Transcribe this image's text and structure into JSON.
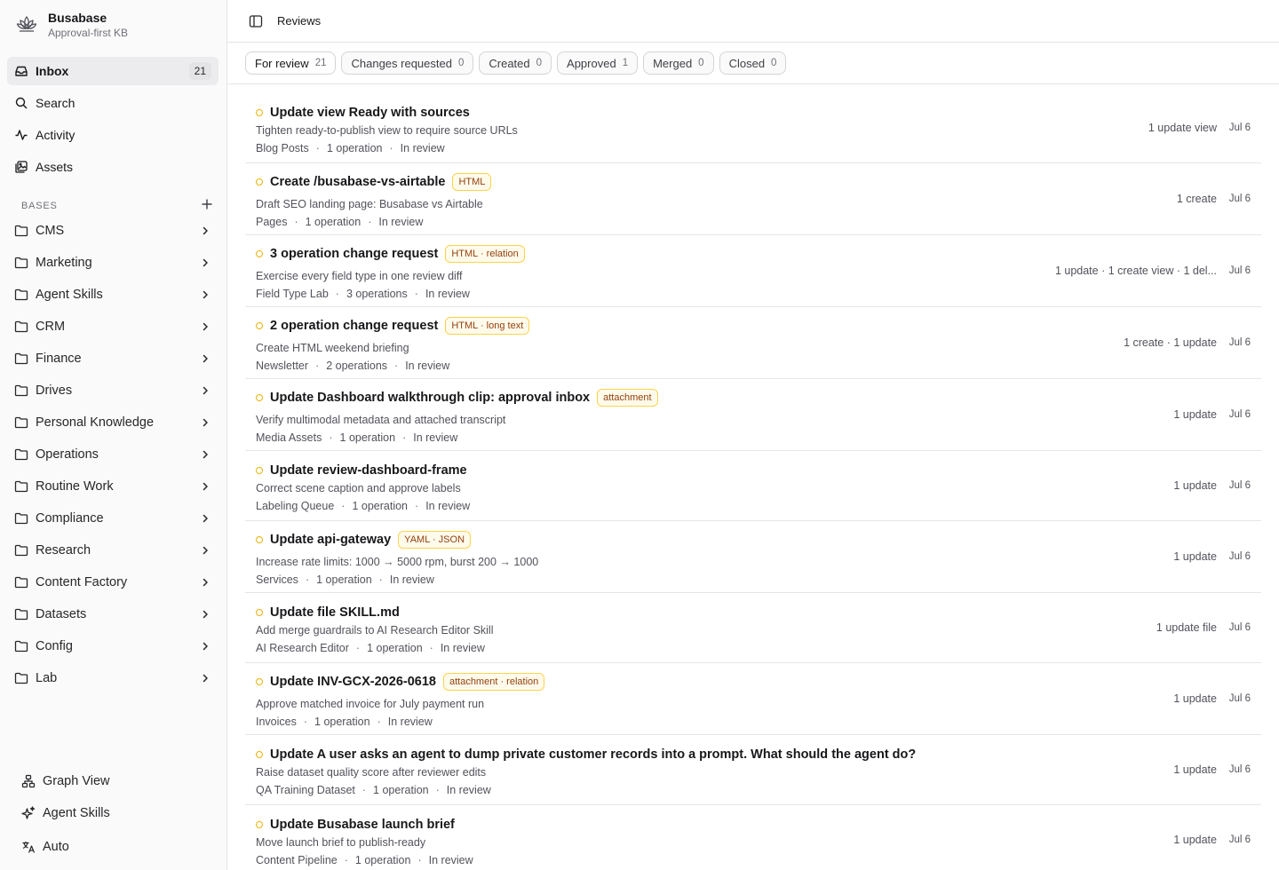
{
  "brand": {
    "name": "Busabase",
    "subtitle": "Approval-first KB"
  },
  "nav": [
    {
      "label": "Inbox",
      "badge": "21",
      "icon": "inbox-icon"
    },
    {
      "label": "Search",
      "icon": "search-icon"
    },
    {
      "label": "Activity",
      "icon": "activity-icon"
    },
    {
      "label": "Assets",
      "icon": "assets-icon"
    }
  ],
  "bases_label": "BASES",
  "bases": [
    "CMS",
    "Marketing",
    "Agent Skills",
    "CRM",
    "Finance",
    "Drives",
    "Personal Knowledge",
    "Operations",
    "Routine Work",
    "Compliance",
    "Research",
    "Content Factory",
    "Datasets",
    "Config",
    "Lab"
  ],
  "footer": [
    {
      "label": "Graph View",
      "icon": "graph-icon"
    },
    {
      "label": "Agent Skills",
      "icon": "sparkles-icon"
    },
    {
      "label": "Auto",
      "icon": "language-icon"
    }
  ],
  "header": {
    "title": "Reviews"
  },
  "tabs": [
    {
      "label": "For review",
      "count": "21",
      "active": true
    },
    {
      "label": "Changes requested",
      "count": "0"
    },
    {
      "label": "Created",
      "count": "0"
    },
    {
      "label": "Approved",
      "count": "1"
    },
    {
      "label": "Merged",
      "count": "0"
    },
    {
      "label": "Closed",
      "count": "0"
    }
  ],
  "reviews": [
    {
      "title": "Update view Ready with sources",
      "tag": "",
      "desc": "Tighten ready-to-publish view to require source URLs",
      "base": "Blog Posts",
      "ops": "1 operation",
      "status": "In review",
      "summary": "1 update view",
      "date": "Jul 6"
    },
    {
      "title": "Create /busabase-vs-airtable",
      "tag": "HTML",
      "desc": "Draft SEO landing page: Busabase vs Airtable",
      "base": "Pages",
      "ops": "1 operation",
      "status": "In review",
      "summary": "1 create",
      "date": "Jul 6"
    },
    {
      "title": "3 operation change request",
      "tag": "HTML · relation",
      "desc": "Exercise every field type in one review diff",
      "base": "Field Type Lab",
      "ops": "3 operations",
      "status": "In review",
      "summary": "1 update · 1 create view · 1 del...",
      "date": "Jul 6"
    },
    {
      "title": "2 operation change request",
      "tag": "HTML · long text",
      "desc": "Create HTML weekend briefing",
      "base": "Newsletter",
      "ops": "2 operations",
      "status": "In review",
      "summary": "1 create · 1 update",
      "date": "Jul 6"
    },
    {
      "title": "Update Dashboard walkthrough clip: approval inbox",
      "tag": "attachment",
      "desc": "Verify multimodal metadata and attached transcript",
      "base": "Media Assets",
      "ops": "1 operation",
      "status": "In review",
      "summary": "1 update",
      "date": "Jul 6"
    },
    {
      "title": "Update review-dashboard-frame",
      "tag": "",
      "desc": "Correct scene caption and approve labels",
      "base": "Labeling Queue",
      "ops": "1 operation",
      "status": "In review",
      "summary": "1 update",
      "date": "Jul 6"
    },
    {
      "title": "Update api-gateway",
      "tag": "YAML · JSON",
      "desc": "Increase rate limits: 1000 → 5000 rpm, burst 200 → 1000",
      "base": "Services",
      "ops": "1 operation",
      "status": "In review",
      "summary": "1 update",
      "date": "Jul 6"
    },
    {
      "title": "Update file SKILL.md",
      "tag": "",
      "desc": "Add merge guardrails to AI Research Editor Skill",
      "base": "AI Research Editor",
      "ops": "1 operation",
      "status": "In review",
      "summary": "1 update file",
      "date": "Jul 6"
    },
    {
      "title": "Update INV-GCX-2026-0618",
      "tag": "attachment · relation",
      "desc": "Approve matched invoice for July payment run",
      "base": "Invoices",
      "ops": "1 operation",
      "status": "In review",
      "summary": "1 update",
      "date": "Jul 6"
    },
    {
      "title": "Update A user asks an agent to dump private customer records into a prompt. What should the agent do?",
      "tag": "",
      "desc": "Raise dataset quality score after reviewer edits",
      "base": "QA Training Dataset",
      "ops": "1 operation",
      "status": "In review",
      "summary": "1 update",
      "date": "Jul 6"
    },
    {
      "title": "Update Busabase launch brief",
      "tag": "",
      "desc": "Move launch brief to publish-ready",
      "base": "Content Pipeline",
      "ops": "1 operation",
      "status": "In review",
      "summary": "1 update",
      "date": "Jul 6"
    }
  ]
}
